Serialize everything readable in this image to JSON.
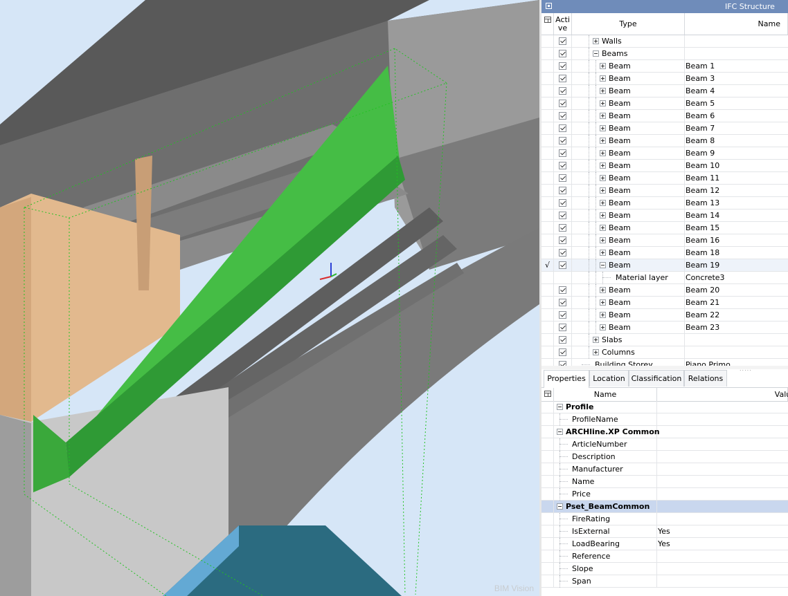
{
  "viewport": {
    "watermark": "BIM Vision",
    "colors": {
      "sky": "#d9e8f8",
      "beam_selected": "#45bd45",
      "concrete": "#8c8c8c",
      "wood": "#e2b98e",
      "water": "#2c6f84",
      "bbox": "#22c222"
    }
  },
  "panel": {
    "title": "IFC Structure"
  },
  "tree": {
    "headers": {
      "active": "Active",
      "type": "Type",
      "name": "Name"
    },
    "rows": [
      {
        "mark": "",
        "level": 2,
        "exp": "plus",
        "type": "Walls",
        "name": ""
      },
      {
        "mark": "",
        "level": 2,
        "exp": "minus",
        "type": "Beams",
        "name": ""
      },
      {
        "mark": "",
        "level": 3,
        "exp": "plus",
        "type": "Beam",
        "name": "Beam 1"
      },
      {
        "mark": "",
        "level": 3,
        "exp": "plus",
        "type": "Beam",
        "name": "Beam 3"
      },
      {
        "mark": "",
        "level": 3,
        "exp": "plus",
        "type": "Beam",
        "name": "Beam 4"
      },
      {
        "mark": "",
        "level": 3,
        "exp": "plus",
        "type": "Beam",
        "name": "Beam 5"
      },
      {
        "mark": "",
        "level": 3,
        "exp": "plus",
        "type": "Beam",
        "name": "Beam 6"
      },
      {
        "mark": "",
        "level": 3,
        "exp": "plus",
        "type": "Beam",
        "name": "Beam 7"
      },
      {
        "mark": "",
        "level": 3,
        "exp": "plus",
        "type": "Beam",
        "name": "Beam 8"
      },
      {
        "mark": "",
        "level": 3,
        "exp": "plus",
        "type": "Beam",
        "name": "Beam 9"
      },
      {
        "mark": "",
        "level": 3,
        "exp": "plus",
        "type": "Beam",
        "name": "Beam 10"
      },
      {
        "mark": "",
        "level": 3,
        "exp": "plus",
        "type": "Beam",
        "name": "Beam 11"
      },
      {
        "mark": "",
        "level": 3,
        "exp": "plus",
        "type": "Beam",
        "name": "Beam 12"
      },
      {
        "mark": "",
        "level": 3,
        "exp": "plus",
        "type": "Beam",
        "name": "Beam 13"
      },
      {
        "mark": "",
        "level": 3,
        "exp": "plus",
        "type": "Beam",
        "name": "Beam 14"
      },
      {
        "mark": "",
        "level": 3,
        "exp": "plus",
        "type": "Beam",
        "name": "Beam 15"
      },
      {
        "mark": "",
        "level": 3,
        "exp": "plus",
        "type": "Beam",
        "name": "Beam 16"
      },
      {
        "mark": "",
        "level": 3,
        "exp": "plus",
        "type": "Beam",
        "name": "Beam 18"
      },
      {
        "mark": "√",
        "level": 3,
        "exp": "minus",
        "type": "Beam",
        "name": "Beam 19",
        "selected": true
      },
      {
        "mark": "",
        "level": 4,
        "exp": "none",
        "type": "Material layer",
        "name": "Concrete3",
        "no_check": true
      },
      {
        "mark": "",
        "level": 3,
        "exp": "plus",
        "type": "Beam",
        "name": "Beam 20"
      },
      {
        "mark": "",
        "level": 3,
        "exp": "plus",
        "type": "Beam",
        "name": "Beam 21"
      },
      {
        "mark": "",
        "level": 3,
        "exp": "plus",
        "type": "Beam",
        "name": "Beam 22"
      },
      {
        "mark": "",
        "level": 3,
        "exp": "plus",
        "type": "Beam",
        "name": "Beam 23"
      },
      {
        "mark": "",
        "level": 2,
        "exp": "plus",
        "type": "Slabs",
        "name": ""
      },
      {
        "mark": "",
        "level": 2,
        "exp": "plus",
        "type": "Columns",
        "name": ""
      },
      {
        "mark": "",
        "level": 1,
        "exp": "none",
        "type": "Building Storey",
        "name": "Piano Primo"
      }
    ]
  },
  "tabs": [
    "Properties",
    "Location",
    "Classification",
    "Relations"
  ],
  "properties": {
    "headers": {
      "name": "Name",
      "value": "Value"
    },
    "rows": [
      {
        "kind": "group",
        "label": "Profile",
        "value": ""
      },
      {
        "kind": "prop",
        "label": "ProfileName",
        "value": ""
      },
      {
        "kind": "group",
        "label": "ARCHline.XP Common",
        "value": ""
      },
      {
        "kind": "prop",
        "label": "ArticleNumber",
        "value": ""
      },
      {
        "kind": "prop",
        "label": "Description",
        "value": ""
      },
      {
        "kind": "prop",
        "label": "Manufacturer",
        "value": ""
      },
      {
        "kind": "prop",
        "label": "Name",
        "value": ""
      },
      {
        "kind": "prop",
        "label": "Price",
        "value": ""
      },
      {
        "kind": "group",
        "label": "Pset_BeamCommon",
        "value": "",
        "selected": true
      },
      {
        "kind": "prop",
        "label": "FireRating",
        "value": ""
      },
      {
        "kind": "prop",
        "label": "IsExternal",
        "value": "Yes"
      },
      {
        "kind": "prop",
        "label": "LoadBearing",
        "value": "Yes"
      },
      {
        "kind": "prop",
        "label": "Reference",
        "value": ""
      },
      {
        "kind": "prop",
        "label": "Slope",
        "value": ""
      },
      {
        "kind": "prop",
        "label": "Span",
        "value": ""
      }
    ]
  }
}
